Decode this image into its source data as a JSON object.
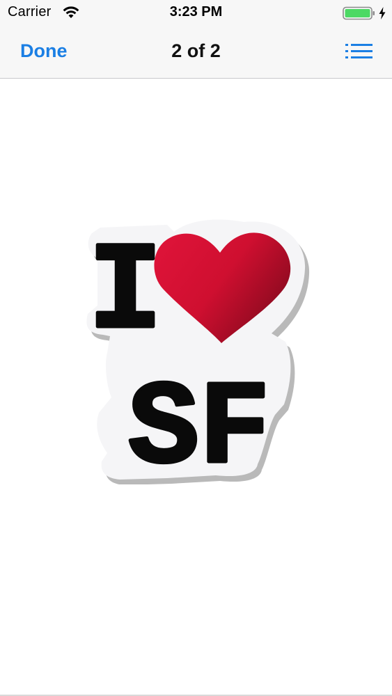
{
  "status_bar": {
    "carrier": "Carrier",
    "time": "3:23 PM",
    "battery_color": "#4cd964"
  },
  "nav_bar": {
    "done_label": "Done",
    "title": "2 of 2",
    "accent_color": "#1b7fe4"
  },
  "document": {
    "sticker_line1": "I",
    "sticker_line2": "SF",
    "heart_color": "#d0102f"
  },
  "icons": {
    "wifi": "wifi-icon",
    "battery": "battery-icon",
    "charging": "charging-bolt-icon",
    "list": "list-icon",
    "heart": "heart-icon"
  }
}
